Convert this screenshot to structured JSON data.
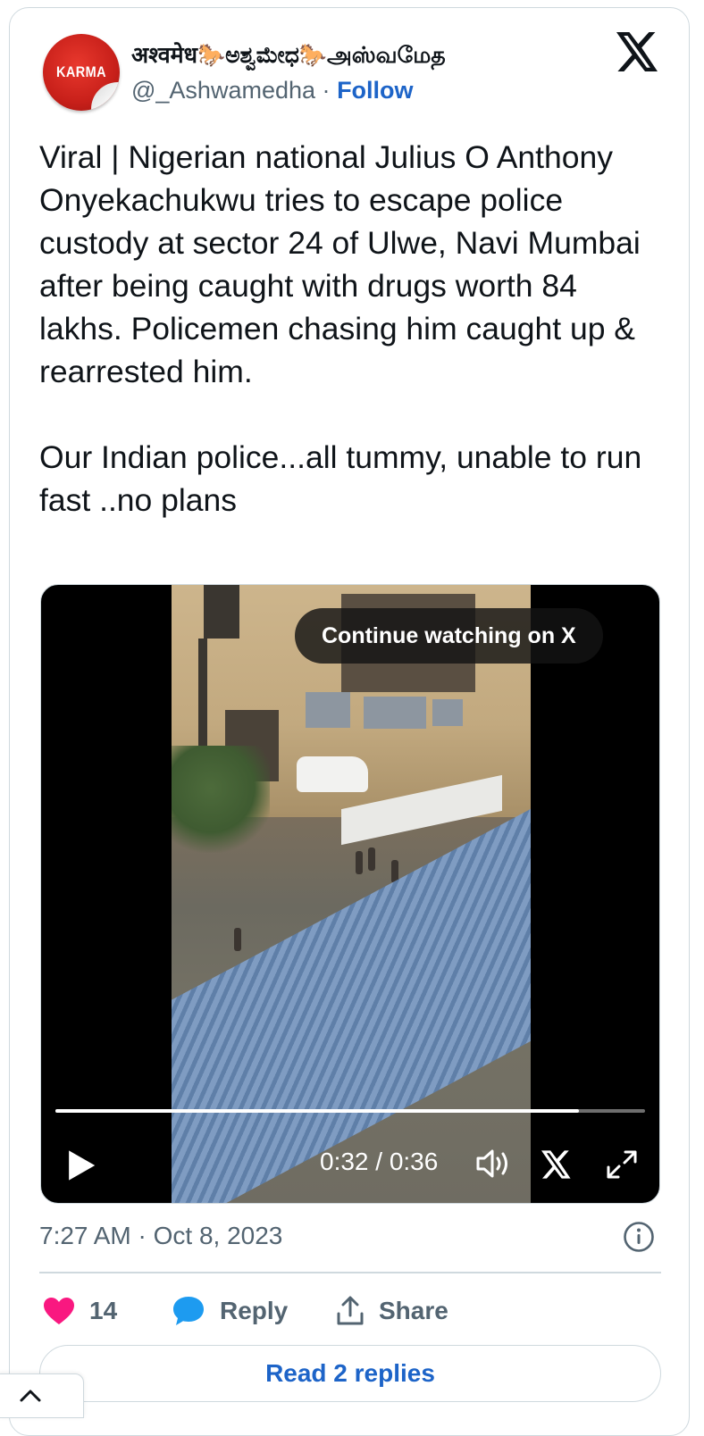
{
  "author": {
    "display_name": "अश्वमेध🐎ಅಶ್ವಮೇಧ🐎அஸ்வமேத",
    "handle": "@_Ashwamedha",
    "separator": "·",
    "follow_label": "Follow",
    "avatar_text": "KARMA"
  },
  "tweet": {
    "text": "Viral | Nigerian national Julius O Anthony Onyekachukwu tries to escape police custody at sector 24 of Ulwe, Navi Mumbai after being caught with drugs worth 84 lakhs. Policemen chasing him caught up & rearrested him.\n\nOur Indian police...all tummy, unable to run fast ..no plans",
    "timestamp": "7:27 AM · Oct 8, 2023"
  },
  "video": {
    "continue_label": "Continue watching on X",
    "time_display": "0:32 / 0:36",
    "progress_fraction": 0.888
  },
  "actions": {
    "like_count": "14",
    "reply_label": "Reply",
    "share_label": "Share",
    "read_replies_label": "Read 2 replies"
  },
  "icons": {
    "brand": "x-logo-icon",
    "like": "heart-icon",
    "reply": "speech-bubble-icon",
    "share": "share-upload-icon",
    "info": "info-icon",
    "play": "play-icon",
    "volume": "volume-icon",
    "fullscreen": "fullscreen-icon",
    "scroll_top": "chevron-up-icon"
  },
  "colors": {
    "text_primary": "#0f1419",
    "text_secondary": "#536471",
    "link_blue": "#1d64c8",
    "like_pink": "#f91880",
    "reply_blue": "#1d9bf0",
    "border": "#cfd9de"
  }
}
